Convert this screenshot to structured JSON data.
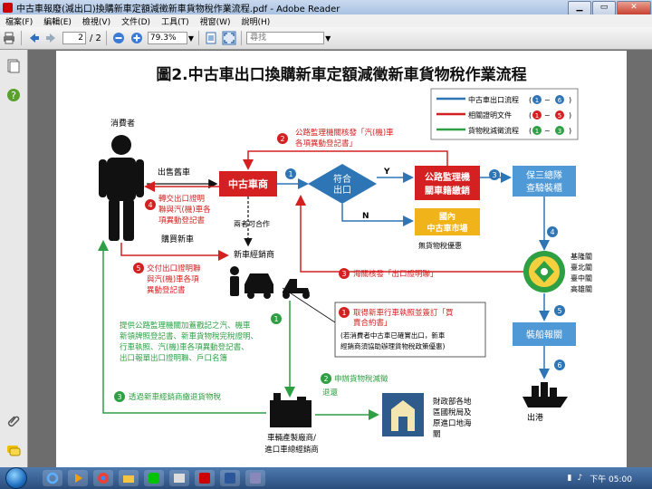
{
  "window": {
    "title": "中古車報廢(減出口)換購新車定額減徵新車貨物稅作業流程.pdf - Adobe Reader"
  },
  "menu": [
    "檔案(F)",
    "編輯(E)",
    "檢視(V)",
    "文件(D)",
    "工具(T)",
    "視窗(W)",
    "說明(H)"
  ],
  "toolbar": {
    "page_current": "2",
    "page_total": "/ 2",
    "zoom": "79.3%",
    "search_placeholder": "尋找"
  },
  "doc": {
    "title": "圖2.中古車出口換購新車定額減徵新車貨物稅作業流程",
    "legend": [
      {
        "label": "中古車出口流程",
        "range_from": "1",
        "range_to": "6",
        "color": "#2e75b6"
      },
      {
        "label": "相關證明文件",
        "range_from": "1",
        "range_to": "5",
        "color": "#d42020"
      },
      {
        "label": "貨物稅減徵流程",
        "range_from": "1",
        "range_to": "3",
        "color": "#2ea043"
      }
    ],
    "labels": {
      "consumer": "消費者",
      "sell_old": "出售舊車",
      "buy_new": "購買新車",
      "used_dealer": "中古車商",
      "coop": "兩者可合作",
      "new_dealer": "新車經銷商",
      "export_q_1": "符合",
      "export_q_2": "出口",
      "yes": "Y",
      "no": "N",
      "dmv_1": "公路監理機",
      "dmv_2": "關車籍繳銷",
      "domestic_1": "國內",
      "domestic_2": "中古車市場",
      "no_benefit": "無貨物稅優惠",
      "police_1": "保三總隊",
      "police_2": "查驗裝櫃",
      "ports": [
        "基隆關",
        "臺北關",
        "臺中關",
        "高雄關"
      ],
      "ship_customs": "裝船報關",
      "export_port": "出港",
      "manufacturer_1": "車輛產製廠商/",
      "manufacturer_2": "進口車總經銷商",
      "tax_office": [
        "財政部各地",
        "區國稅局及",
        "原進口地海",
        "關"
      ]
    },
    "notes": {
      "red2": [
        "公路監理機關核發「汽(機)車",
        "各項異動登記書」"
      ],
      "red4": [
        "轉交出口證明",
        "聯與汽(機)車各",
        "項異動登記書"
      ],
      "red3": "海關核發「出口證明聯」",
      "red5": [
        "交付出口證明聯",
        "與汽(機)車各項",
        "異動登記書"
      ],
      "red1_a": [
        "取得新車行車執照並簽訂「買",
        "賣合約書」"
      ],
      "red1_b": [
        "(若消費者中古車已確實出口，新車",
        "經銷商須協助辦理貨物稅政策優惠)"
      ],
      "green1": [
        "提供公路監理機關加蓋戳記之汽、機車",
        "新領牌照登記書、新車貨物稅完稅證明、",
        "行車執照、汽(機)車各項異動登記書、",
        "出口報單出口證明聯、戶口名簿"
      ],
      "green2": [
        "申辦貨物稅減徵",
        "退還"
      ],
      "green3": "透過新車經銷商繳退貨物稅"
    }
  },
  "taskbar": {
    "time": "下午 05:00"
  }
}
